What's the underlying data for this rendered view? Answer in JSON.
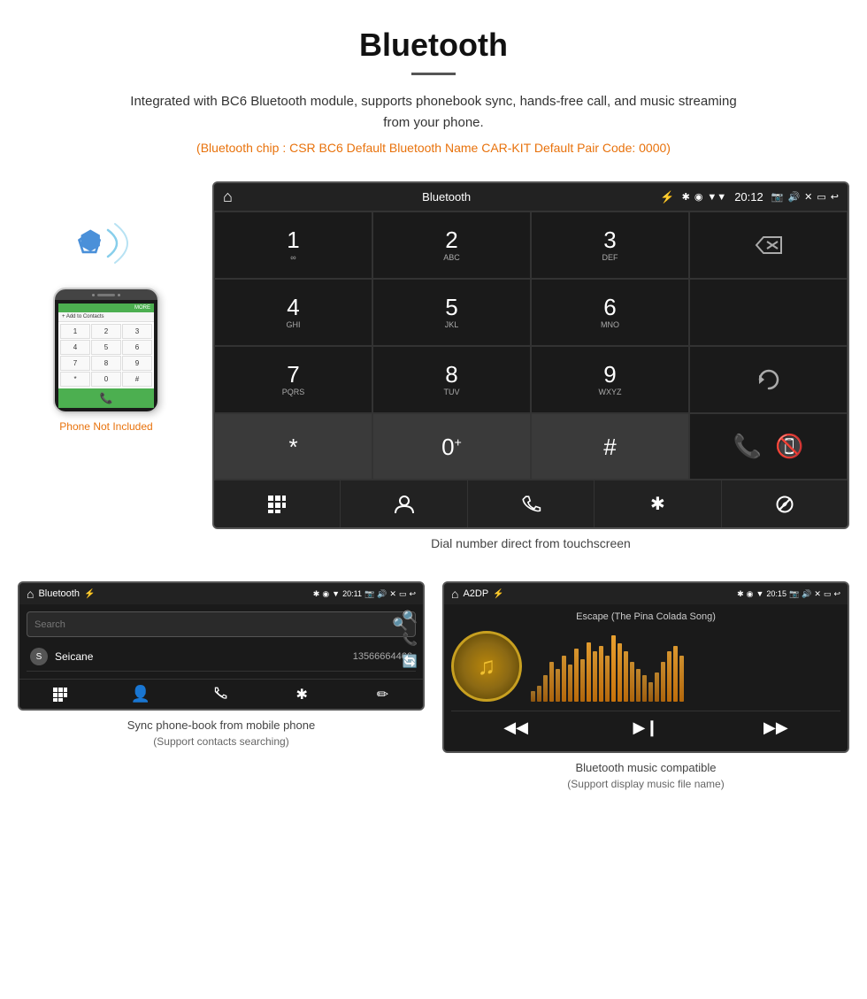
{
  "header": {
    "title": "Bluetooth",
    "divider": true,
    "description": "Integrated with BC6 Bluetooth module, supports phonebook sync, hands-free call, and music streaming from your phone.",
    "info_line": "(Bluetooth chip : CSR BC6    Default Bluetooth Name CAR-KIT    Default Pair Code: 0000)"
  },
  "car_screen": {
    "status_bar": {
      "home_icon": "⌂",
      "title": "Bluetooth",
      "usb_icon": "⚡",
      "bt_icon": "✱",
      "pin_icon": "◉",
      "signal_icon": "▼",
      "time": "20:12",
      "camera_icon": "📷",
      "volume_icon": "🔊",
      "x_icon": "✕",
      "window_icon": "▭",
      "back_icon": "↩"
    },
    "dialpad": [
      {
        "num": "1",
        "sub": "∞",
        "col": 0
      },
      {
        "num": "2",
        "sub": "ABC",
        "col": 1
      },
      {
        "num": "3",
        "sub": "DEF",
        "col": 2
      },
      {
        "num": "",
        "sub": "",
        "action": "backspace",
        "col": 3
      },
      {
        "num": "4",
        "sub": "GHI",
        "col": 0
      },
      {
        "num": "5",
        "sub": "JKL",
        "col": 1
      },
      {
        "num": "6",
        "sub": "MNO",
        "col": 2
      },
      {
        "num": "",
        "sub": "",
        "action": "empty",
        "col": 3
      },
      {
        "num": "7",
        "sub": "PQRS",
        "col": 0
      },
      {
        "num": "8",
        "sub": "TUV",
        "col": 1
      },
      {
        "num": "9",
        "sub": "WXYZ",
        "col": 2
      },
      {
        "num": "",
        "sub": "",
        "action": "refresh",
        "col": 3
      },
      {
        "num": "*",
        "sub": "",
        "col": 0
      },
      {
        "num": "0",
        "sub": "+",
        "col": 1
      },
      {
        "num": "#",
        "sub": "",
        "col": 2
      },
      {
        "num": "",
        "sub": "",
        "action": "call_green",
        "col": 3
      },
      {
        "num": "",
        "sub": "",
        "action": "call_red",
        "col": 3
      }
    ],
    "action_bar": [
      {
        "icon": "⊞",
        "name": "dialpad"
      },
      {
        "icon": "👤",
        "name": "contacts"
      },
      {
        "icon": "📞",
        "name": "calls"
      },
      {
        "icon": "✱",
        "name": "bluetooth"
      },
      {
        "icon": "🔗",
        "name": "link"
      }
    ]
  },
  "phone_mockup": {
    "keys": [
      "1",
      "2",
      "3",
      "4",
      "5",
      "6",
      "7",
      "8",
      "9",
      "*",
      "0",
      "#"
    ],
    "not_included_text": "Phone Not Included"
  },
  "dial_caption": "Dial number direct from touchscreen",
  "phonebook_screen": {
    "status_bar": {
      "home_icon": "⌂",
      "title": "Bluetooth",
      "usb_icon": "⚡",
      "bt_icon": "✱",
      "pin_icon": "◉",
      "signal_icon": "▼",
      "time": "20:11",
      "icons_right": "📷 🔊 ✕ ▭ ↩"
    },
    "search_placeholder": "Search",
    "contacts": [
      {
        "letter": "S",
        "name": "Seicane",
        "number": "13566664466"
      }
    ],
    "side_icons": [
      "🔍",
      "📞",
      "🔄"
    ],
    "action_bar": [
      "⊞",
      "👤",
      "📞",
      "✱",
      "✏"
    ]
  },
  "music_screen": {
    "status_bar": {
      "home_icon": "⌂",
      "title": "A2DP",
      "usb_icon": "⚡",
      "bt_icon": "✱",
      "pin_icon": "◉",
      "signal_icon": "▼",
      "time": "20:15",
      "icons_right": "📷 🔊 ✕ ▭ ↩"
    },
    "song_title": "Escape (The Pina Colada Song)",
    "controls": [
      "⏮",
      "⏯",
      "⏭"
    ],
    "visualizer_bars": [
      8,
      12,
      20,
      30,
      25,
      35,
      28,
      40,
      32,
      45,
      38,
      42,
      35,
      50,
      44,
      38,
      30,
      25,
      20,
      15,
      22,
      30,
      38,
      42,
      35
    ]
  },
  "bottom_captions": [
    {
      "main": "Sync phone-book from mobile phone",
      "sub": "(Support contacts searching)"
    },
    {
      "main": "Bluetooth music compatible",
      "sub": "(Support display music file name)"
    }
  ]
}
